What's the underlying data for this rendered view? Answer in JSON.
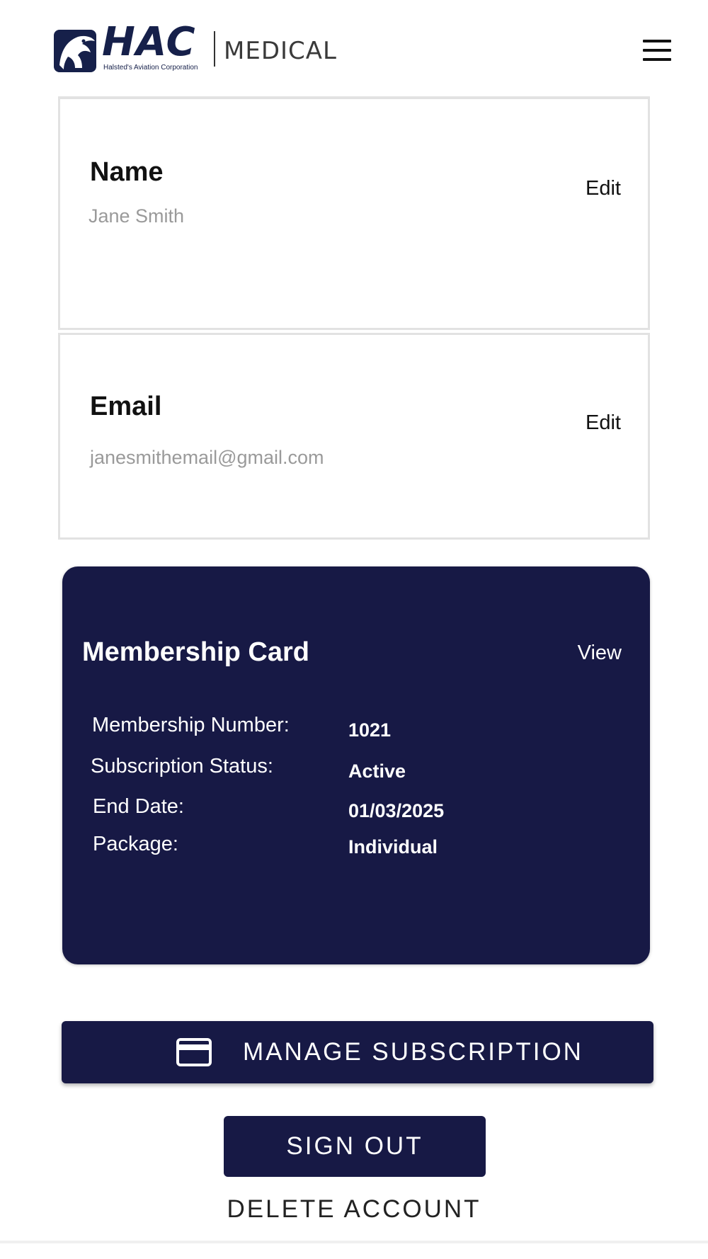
{
  "header": {
    "logo_title": "HAC",
    "logo_subtitle": "Halsted's Aviation Corporation",
    "logo_product": "MEDICAL",
    "menu_icon": "hamburger-menu-icon"
  },
  "profile": {
    "name": {
      "label": "Name",
      "value": "Jane Smith",
      "edit_label": "Edit"
    },
    "email": {
      "label": "Email",
      "value": "janesmithemail@gmail.com",
      "edit_label": "Edit"
    }
  },
  "membership": {
    "title": "Membership Card",
    "view_label": "View",
    "rows": [
      {
        "label": "Membership Number:",
        "value": "1021"
      },
      {
        "label": "Subscription Status:",
        "value": "Active"
      },
      {
        "label": "End Date:",
        "value": "01/03/2025"
      },
      {
        "label": "Package:",
        "value": "Individual"
      }
    ]
  },
  "actions": {
    "manage_subscription": "MANAGE SUBSCRIPTION",
    "manage_icon": "credit-card-icon",
    "sign_out": "SIGN OUT",
    "delete_account": "DELETE ACCOUNT"
  },
  "colors": {
    "brand_navy": "#171945",
    "logo_navy": "#16204a",
    "muted_text": "#9a9a9a",
    "card_border": "#e2e2e2"
  }
}
